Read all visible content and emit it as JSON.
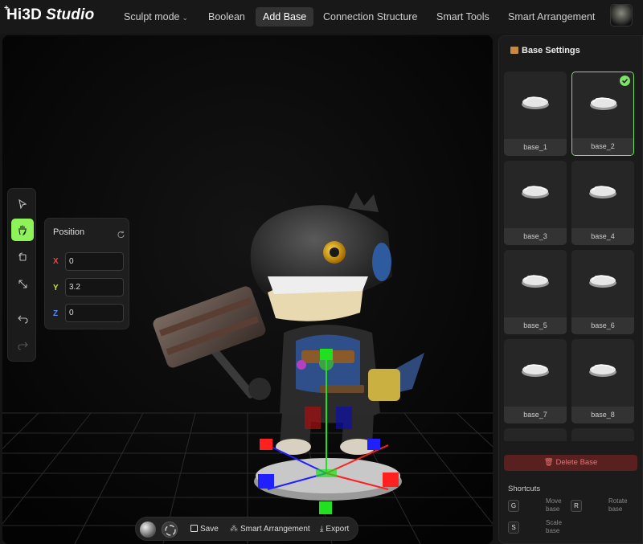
{
  "app": {
    "logo_main": "Hi3D",
    "logo_sub": "Studio",
    "logo_plus": "+"
  },
  "nav": {
    "items": [
      {
        "label": "Sculpt mode",
        "dropdown": true
      },
      {
        "label": "Boolean"
      },
      {
        "label": "Add Base",
        "active": true
      },
      {
        "label": "Connection Structure"
      },
      {
        "label": "Smart Tools"
      },
      {
        "label": "Smart Arrangement"
      }
    ]
  },
  "tools": [
    "select-icon",
    "hand-icon",
    "rotate-icon",
    "scale-icon",
    "undo-icon",
    "redo-icon"
  ],
  "active_tool": "hand-icon",
  "position_panel": {
    "title": "Position",
    "x_label": "X",
    "y_label": "Y",
    "z_label": "Z",
    "x": "0",
    "y": "3.2",
    "z": "0"
  },
  "bottom_bar": {
    "save": "Save",
    "arrange": "Smart Arrangement",
    "export": "Export"
  },
  "base_settings": {
    "title": "Base Settings",
    "bases": [
      "base_1",
      "base_2",
      "base_3",
      "base_4",
      "base_5",
      "base_6",
      "base_7",
      "base_8"
    ],
    "selected": "base_2",
    "delete_label": "Delete Base"
  },
  "shortcuts": {
    "title": "Shortcuts",
    "items": [
      {
        "key": "G",
        "desc": "Move base"
      },
      {
        "key": "R",
        "desc": "Rotate base"
      },
      {
        "key": "S",
        "desc": "Scale base"
      }
    ]
  },
  "colors": {
    "accent": "#8ef25a",
    "selected_border": "#7ee26a",
    "gizmo_x": "#ff2020",
    "gizmo_y": "#20e020",
    "gizmo_z": "#2020ff",
    "delete_bg": "#5a2020",
    "delete_text": "#e37474"
  }
}
